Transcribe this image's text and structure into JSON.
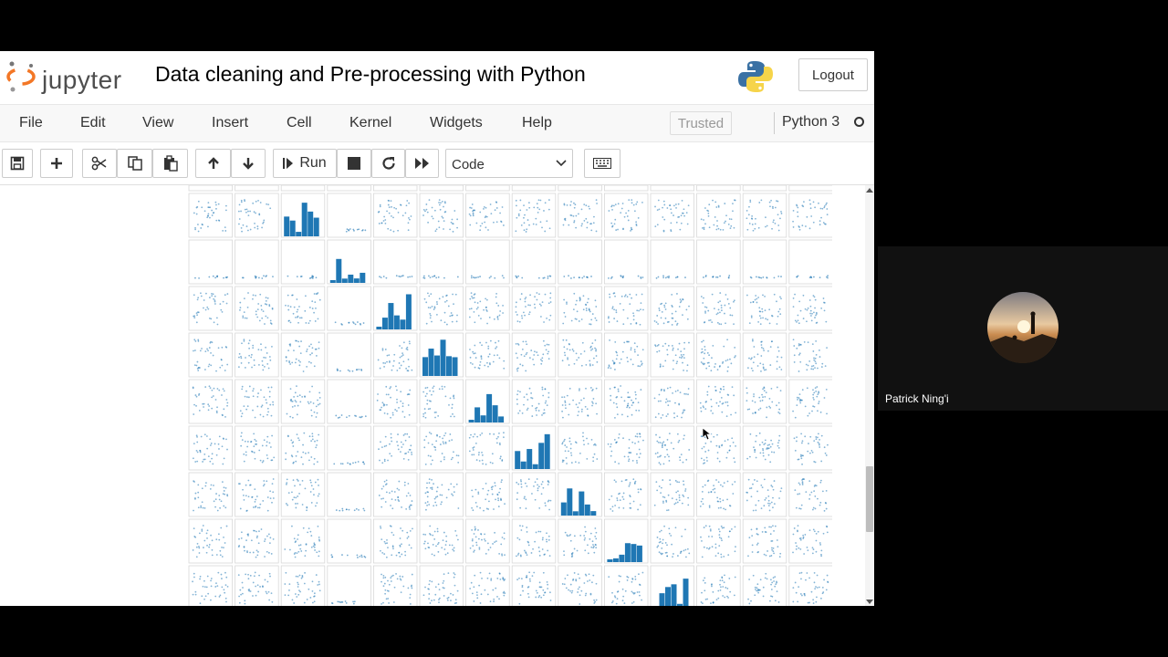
{
  "header": {
    "logo_text": "jupyter",
    "notebook_title": "Data cleaning and Pre-processing with Python",
    "logout_label": "Logout"
  },
  "menu": {
    "items": [
      "File",
      "Edit",
      "View",
      "Insert",
      "Cell",
      "Kernel",
      "Widgets",
      "Help"
    ],
    "trusted_label": "Trusted",
    "kernel_name": "Python 3"
  },
  "toolbar": {
    "icons": [
      "save-icon",
      "add-cell-icon",
      "cut-icon",
      "copy-icon",
      "paste-icon",
      "move-up-icon",
      "move-down-icon",
      "run-icon",
      "stop-icon",
      "restart-icon",
      "fast-forward-icon",
      "keyboard-icon"
    ],
    "run_label": "Run",
    "cell_type_selected": "Code"
  },
  "output": {
    "type": "scatter-matrix",
    "columns": 14,
    "visible_rows": 9,
    "diagonal_rows": [
      2,
      3,
      4,
      5,
      6,
      7,
      8,
      9,
      10
    ],
    "point_color": "#1f77b4"
  },
  "video": {
    "participant_name": "Patrick Ning'i"
  },
  "colors": {
    "brand_orange": "#f37726",
    "plot_blue": "#1f77b4",
    "toolbar_bg": "#f8f8f8"
  }
}
